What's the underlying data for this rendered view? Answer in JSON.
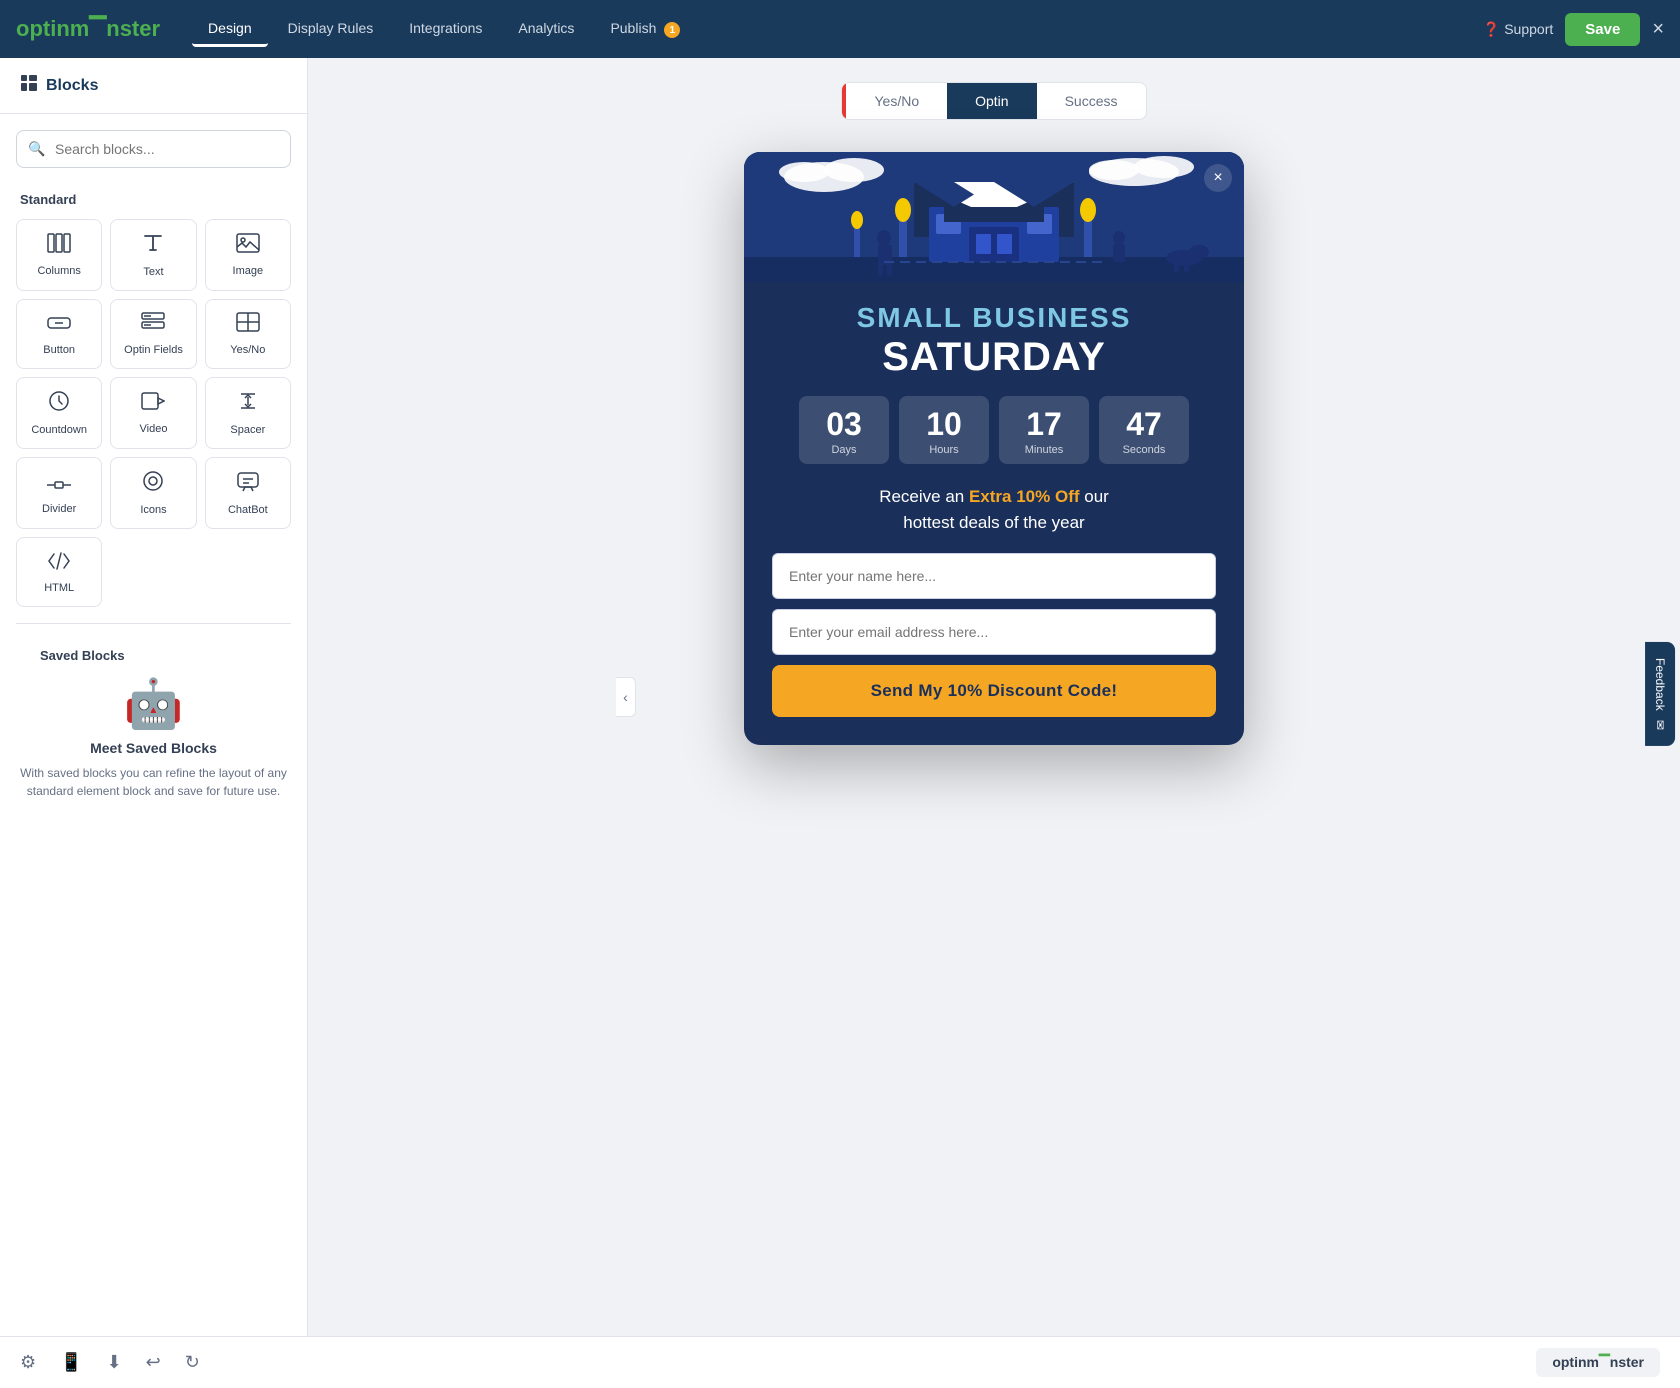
{
  "topnav": {
    "logo_text": "optinm",
    "logo_monster": "👾",
    "logo_suffix": "nster",
    "nav_items": [
      {
        "id": "design",
        "label": "Design",
        "active": true
      },
      {
        "id": "display-rules",
        "label": "Display Rules",
        "active": false
      },
      {
        "id": "integrations",
        "label": "Integrations",
        "active": false
      },
      {
        "id": "analytics",
        "label": "Analytics",
        "active": false
      },
      {
        "id": "publish",
        "label": "Publish",
        "active": false,
        "badge": "1"
      }
    ],
    "support_label": "Support",
    "save_label": "Save",
    "close_label": "×"
  },
  "sidebar": {
    "header_icon": "⊞",
    "header_label": "Blocks",
    "search_placeholder": "Search blocks...",
    "standard_label": "Standard",
    "blocks": [
      {
        "id": "columns",
        "icon": "⊞",
        "label": "Columns"
      },
      {
        "id": "text",
        "icon": "¶",
        "label": "Text"
      },
      {
        "id": "image",
        "icon": "🖼",
        "label": "Image"
      },
      {
        "id": "button",
        "icon": "⏹",
        "label": "Button"
      },
      {
        "id": "optin-fields",
        "icon": "≡",
        "label": "Optin Fields"
      },
      {
        "id": "yes-no",
        "icon": "⇄",
        "label": "Yes/No"
      },
      {
        "id": "countdown",
        "icon": "⏰",
        "label": "Countdown"
      },
      {
        "id": "video",
        "icon": "▶",
        "label": "Video"
      },
      {
        "id": "spacer",
        "icon": "↕",
        "label": "Spacer"
      },
      {
        "id": "divider",
        "icon": "—",
        "label": "Divider"
      },
      {
        "id": "icons",
        "icon": "◎",
        "label": "Icons"
      },
      {
        "id": "chatbot",
        "icon": "💬",
        "label": "ChatBot"
      },
      {
        "id": "html",
        "icon": "</>",
        "label": "HTML"
      }
    ],
    "saved_label": "Saved Blocks",
    "saved_title": "Meet Saved Blocks",
    "saved_desc": "With saved blocks you can refine the layout of any standard element block and save for future use."
  },
  "tabs": [
    {
      "id": "yes-no",
      "label": "Yes/No",
      "active": false
    },
    {
      "id": "optin",
      "label": "Optin",
      "active": true
    },
    {
      "id": "success",
      "label": "Success",
      "active": false
    }
  ],
  "popup": {
    "close_label": "×",
    "title_line1": "SMALL BUSINESS",
    "title_line2": "SATURDAY",
    "countdown": {
      "days": {
        "value": "03",
        "label": "Days"
      },
      "hours": {
        "value": "10",
        "label": "Hours"
      },
      "minutes": {
        "value": "17",
        "label": "Minutes"
      },
      "seconds": {
        "value": "47",
        "label": "Seconds"
      }
    },
    "promo_text_prefix": "Receive an ",
    "promo_highlight": "Extra 10% Off",
    "promo_text_suffix": " our\nhottest deals of the year",
    "name_placeholder": "Enter your name here...",
    "email_placeholder": "Enter your email address here...",
    "submit_label": "Send My 10% Discount Code!"
  },
  "bottombar": {
    "settings_icon": "⚙",
    "mobile_icon": "📱",
    "download_icon": "⬇",
    "undo_icon": "↩",
    "redo_icon": "↻",
    "brand_label": "optinm",
    "brand_monster": "👾",
    "brand_suffix": "nster"
  },
  "feedback": {
    "label": "Feedback"
  }
}
